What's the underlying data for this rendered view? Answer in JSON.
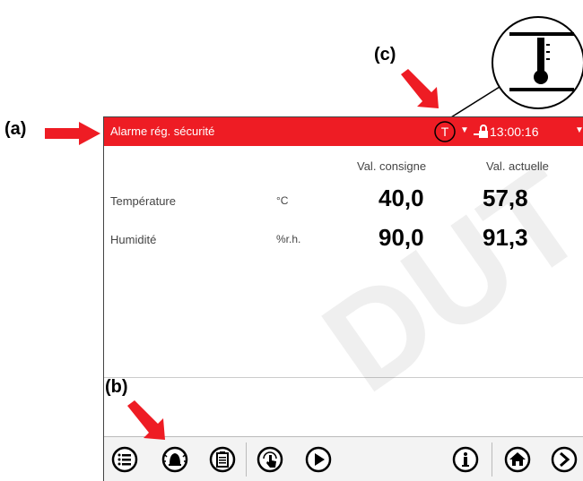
{
  "callouts": {
    "a": "(a)",
    "b": "(b)",
    "c": "(c)"
  },
  "status_bar": {
    "alarm_text": "Alarme rég. sécurité",
    "controller_symbol": "T",
    "time": "13:00:16",
    "color": "#ee1c24"
  },
  "table": {
    "col_setpoint": "Val. consigne",
    "col_actual": "Val. actuelle",
    "rows": [
      {
        "label": "Température",
        "unit": "°C",
        "setpoint": "40,0",
        "actual": "57,8"
      },
      {
        "label": "Humidité",
        "unit": "%r.h.",
        "setpoint": "90,0",
        "actual": "91,3"
      }
    ]
  },
  "toolbar_icons": [
    "list-icon",
    "alarm-bell-icon",
    "clipboard-icon",
    "touch-hand-icon",
    "play-icon",
    "info-icon",
    "home-icon",
    "next-icon"
  ],
  "watermark": "DUT"
}
